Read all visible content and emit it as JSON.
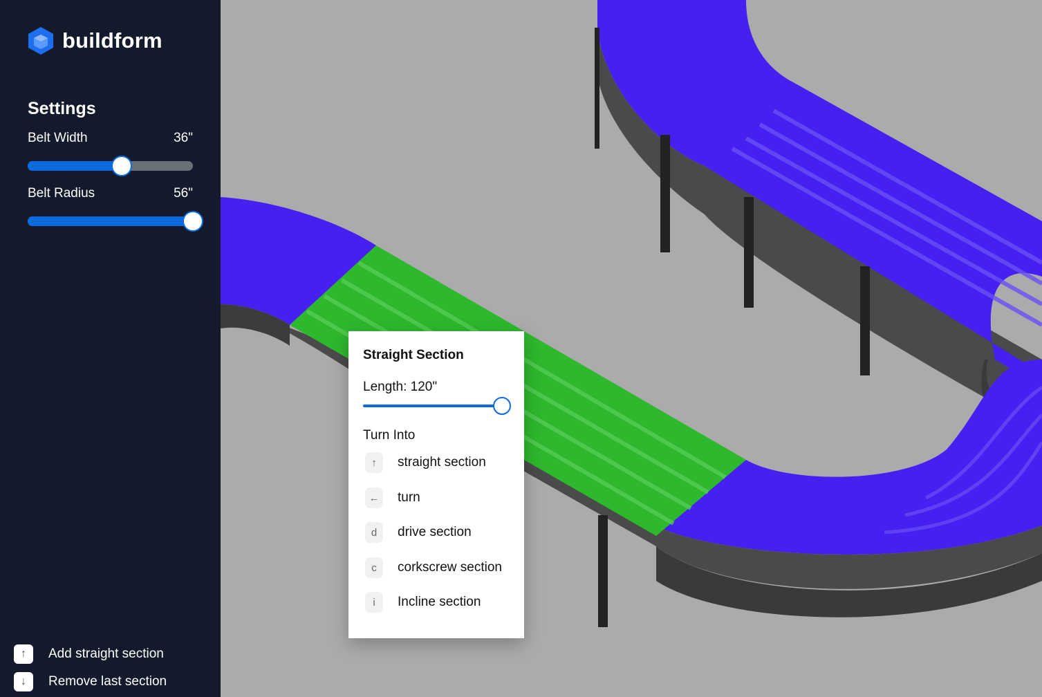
{
  "brand": {
    "name": "buildform",
    "logo_icon": "hexagon-cube-icon"
  },
  "settings": {
    "title": "Settings",
    "belt_width": {
      "label": "Belt Width",
      "value": "36\"",
      "fraction": 0.57
    },
    "belt_radius": {
      "label": "Belt Radius",
      "value": "56\"",
      "fraction": 1.0
    }
  },
  "hints": [
    {
      "key": "↑",
      "label": "Add straight section"
    },
    {
      "key": "↓",
      "label": "Remove last section"
    }
  ],
  "popup": {
    "title": "Straight Section",
    "length_label": "Length: 120\"",
    "length_fraction": 1.0,
    "turn_into_label": "Turn Into",
    "options": [
      {
        "key": "↑",
        "label": "straight section"
      },
      {
        "key": "←",
        "label": "turn"
      },
      {
        "key": "d",
        "label": "drive section"
      },
      {
        "key": "c",
        "label": "corkscrew section"
      },
      {
        "key": "i",
        "label": "Incline section"
      }
    ]
  },
  "colors": {
    "sidebar_bg": "#121a2c",
    "accent": "#0a6be0",
    "belt": "#4620f0",
    "selected": "#2db82d",
    "canvas": "#ababab"
  }
}
